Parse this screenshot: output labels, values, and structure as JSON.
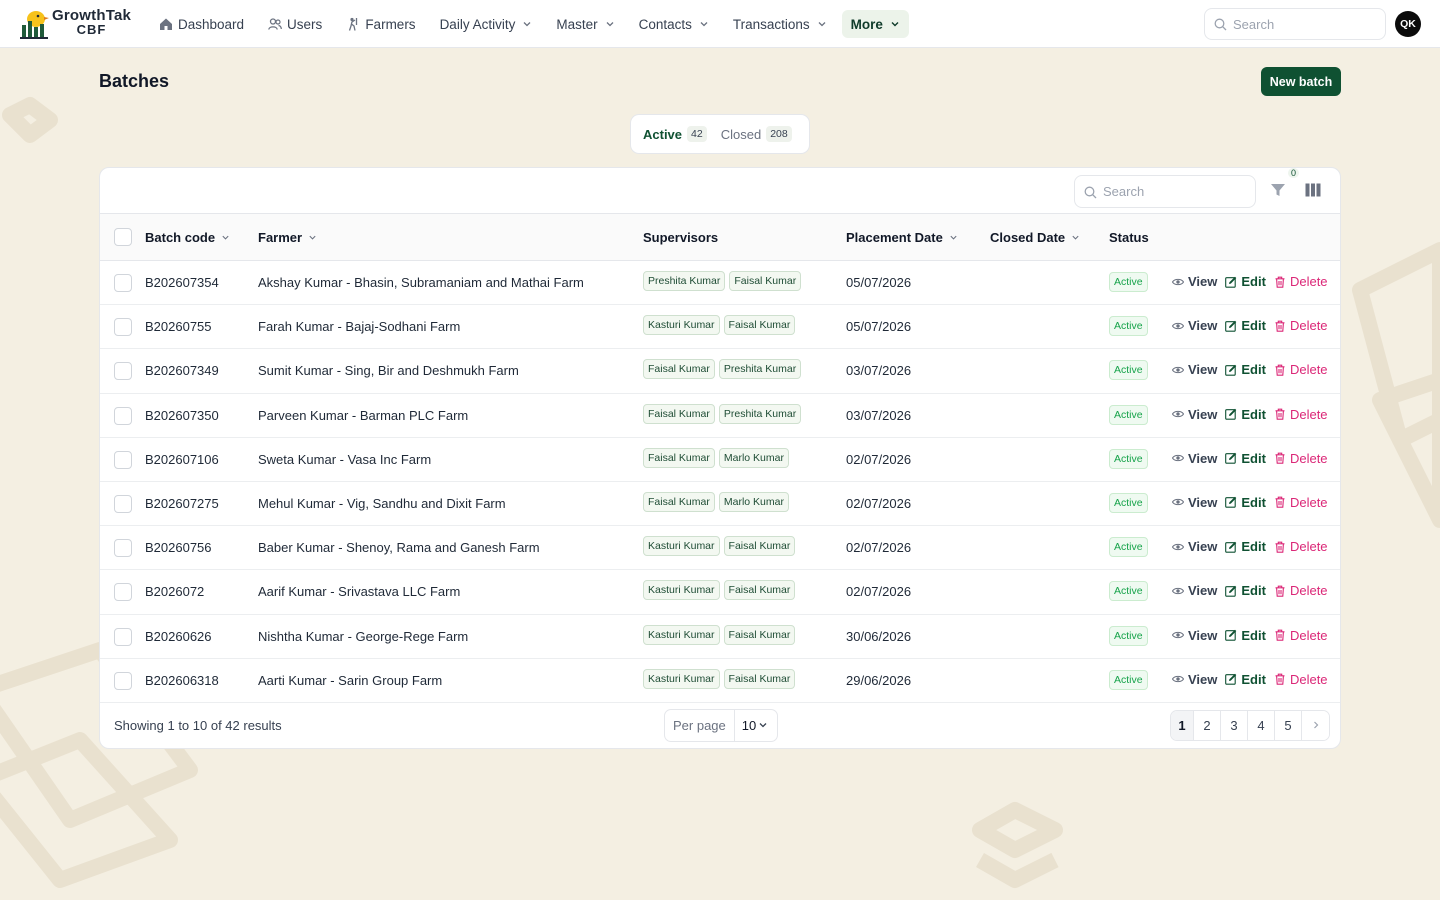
{
  "app": {
    "logo_line1": "GrowthTak",
    "logo_line2": "CBF",
    "search_placeholder": "Search",
    "avatar_initials": "QK"
  },
  "nav": {
    "items": [
      {
        "label": "Dashboard",
        "icon": "home-icon",
        "dropdown": false
      },
      {
        "label": "Users",
        "icon": "users-icon",
        "dropdown": false
      },
      {
        "label": "Farmers",
        "icon": "farmer-icon",
        "dropdown": false
      },
      {
        "label": "Daily Activity",
        "dropdown": true
      },
      {
        "label": "Master",
        "dropdown": true
      },
      {
        "label": "Contacts",
        "dropdown": true
      },
      {
        "label": "Transactions",
        "dropdown": true
      },
      {
        "label": "More",
        "dropdown": true,
        "active": true
      }
    ]
  },
  "page": {
    "title": "Batches",
    "new_button": "New batch"
  },
  "tabs": [
    {
      "label": "Active",
      "count": "42",
      "active": true
    },
    {
      "label": "Closed",
      "count": "208",
      "active": false
    }
  ],
  "table": {
    "search_placeholder": "Search",
    "filter_count": "0",
    "columns": {
      "batch_code": "Batch code",
      "farmer": "Farmer",
      "supervisors": "Supervisors",
      "placement_date": "Placement Date",
      "closed_date": "Closed Date",
      "status": "Status"
    },
    "actions": {
      "view": "View",
      "edit": "Edit",
      "delete": "Delete"
    },
    "rows": [
      {
        "code": "B202607354",
        "farmer": "Akshay Kumar - Bhasin, Subramaniam and Mathai Farm",
        "supervisors": [
          "Preshita Kumar",
          "Faisal Kumar"
        ],
        "placement": "05/07/2026",
        "closed": "",
        "status": "Active"
      },
      {
        "code": "B20260755",
        "farmer": "Farah Kumar - Bajaj-Sodhani Farm",
        "supervisors": [
          "Kasturi Kumar",
          "Faisal Kumar"
        ],
        "placement": "05/07/2026",
        "closed": "",
        "status": "Active"
      },
      {
        "code": "B202607349",
        "farmer": "Sumit Kumar - Sing, Bir and Deshmukh Farm",
        "supervisors": [
          "Faisal Kumar",
          "Preshita Kumar"
        ],
        "placement": "03/07/2026",
        "closed": "",
        "status": "Active"
      },
      {
        "code": "B202607350",
        "farmer": "Parveen Kumar - Barman PLC Farm",
        "supervisors": [
          "Faisal Kumar",
          "Preshita Kumar"
        ],
        "placement": "03/07/2026",
        "closed": "",
        "status": "Active"
      },
      {
        "code": "B202607106",
        "farmer": "Sweta Kumar - Vasa Inc Farm",
        "supervisors": [
          "Faisal Kumar",
          "Marlo Kumar"
        ],
        "placement": "02/07/2026",
        "closed": "",
        "status": "Active"
      },
      {
        "code": "B202607275",
        "farmer": "Mehul Kumar - Vig, Sandhu and Dixit Farm",
        "supervisors": [
          "Faisal Kumar",
          "Marlo Kumar"
        ],
        "placement": "02/07/2026",
        "closed": "",
        "status": "Active"
      },
      {
        "code": "B20260756",
        "farmer": "Baber Kumar - Shenoy, Rama and Ganesh Farm",
        "supervisors": [
          "Kasturi Kumar",
          "Faisal Kumar"
        ],
        "placement": "02/07/2026",
        "closed": "",
        "status": "Active"
      },
      {
        "code": "B2026072",
        "farmer": "Aarif Kumar - Srivastava LLC Farm",
        "supervisors": [
          "Kasturi Kumar",
          "Faisal Kumar"
        ],
        "placement": "02/07/2026",
        "closed": "",
        "status": "Active"
      },
      {
        "code": "B20260626",
        "farmer": "Nishtha Kumar - George-Rege Farm",
        "supervisors": [
          "Kasturi Kumar",
          "Faisal Kumar"
        ],
        "placement": "30/06/2026",
        "closed": "",
        "status": "Active"
      },
      {
        "code": "B202606318",
        "farmer": "Aarti Kumar - Sarin Group Farm",
        "supervisors": [
          "Kasturi Kumar",
          "Faisal Kumar"
        ],
        "placement": "29/06/2026",
        "closed": "",
        "status": "Active"
      }
    ]
  },
  "footer": {
    "showing": "Showing 1 to 10 of 42 results",
    "per_page_label": "Per page",
    "per_page_value": "10",
    "pages": [
      "1",
      "2",
      "3",
      "4",
      "5"
    ],
    "current_page": "1"
  },
  "colors": {
    "brand": "#0f5132",
    "background": "#f4efe2",
    "status_active": "#16a34a",
    "delete": "#db2777"
  }
}
